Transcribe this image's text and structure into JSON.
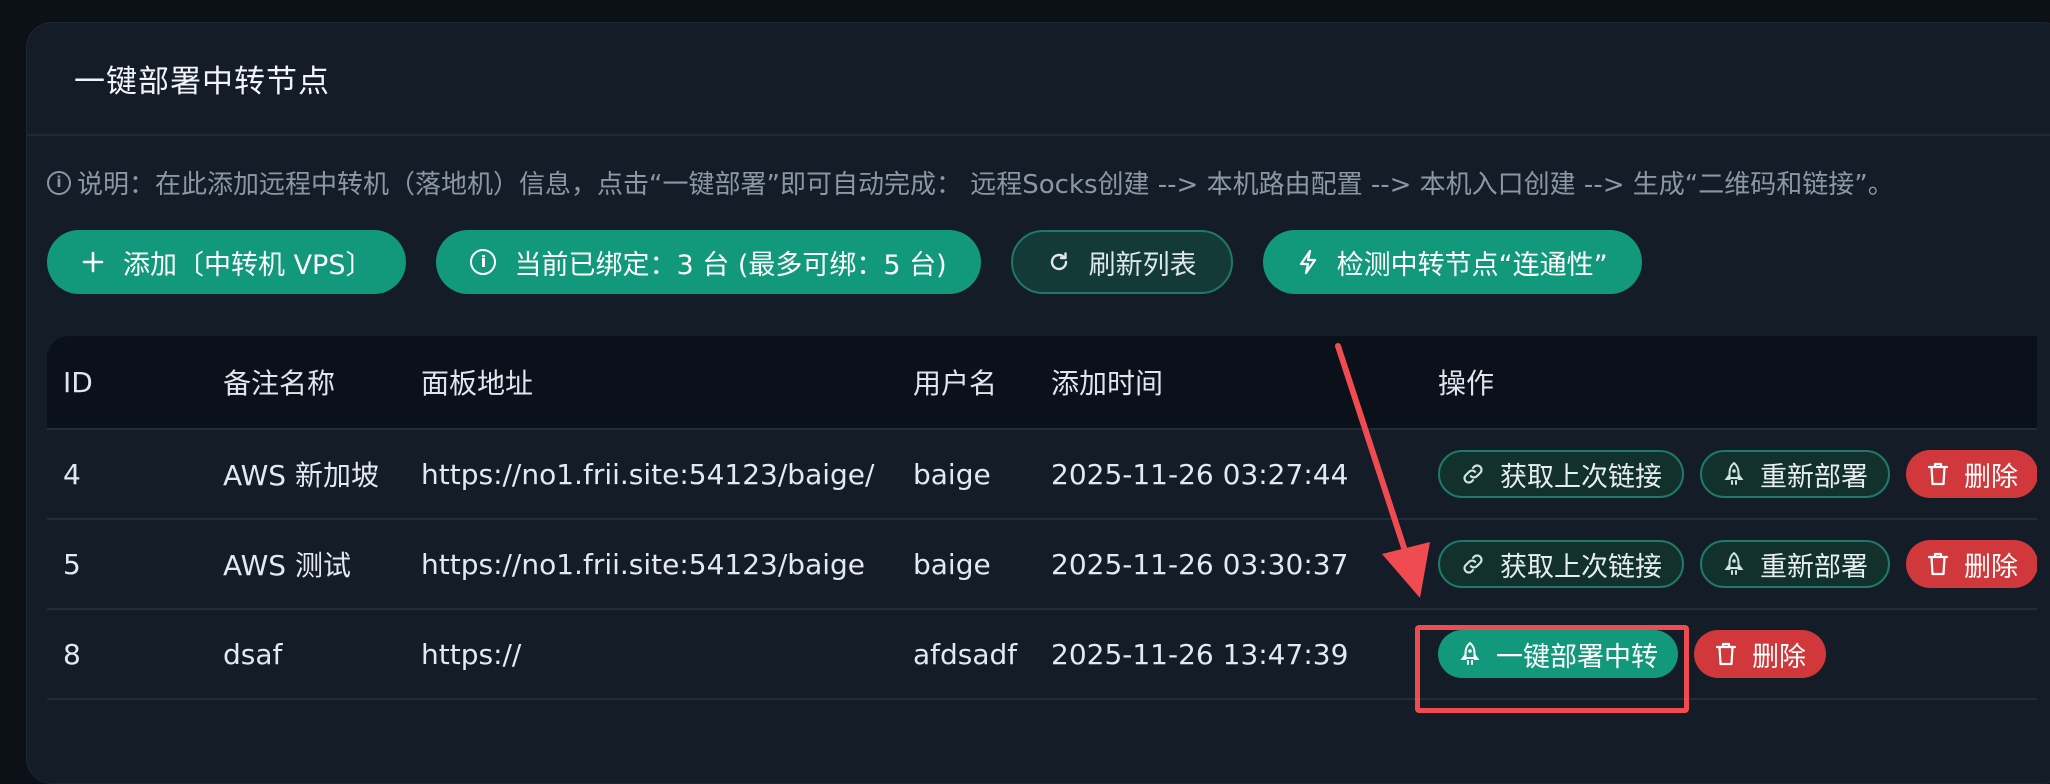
{
  "panel": {
    "title": "一键部署中转节点",
    "notice": "说明：在此添加远程中转机（落地机）信息，点击“一键部署”即可自动完成： 远程Socks创建 --> 本机路由配置 --> 本机入口创建 --> 生成“二维码和链接”。"
  },
  "toolbar": {
    "add_label": "添加〔中转机 VPS〕",
    "bound_label": "当前已绑定：3 台 (最多可绑：5 台)",
    "refresh_label": "刷新列表",
    "check_label": "检测中转节点“连通性”"
  },
  "table": {
    "columns": [
      "ID",
      "备注名称",
      "面板地址",
      "用户名",
      "添加时间",
      "操作"
    ],
    "rows": [
      {
        "id": "4",
        "name": "AWS 新加坡",
        "url": "https://no1.frii.site:54123/baige/",
        "user": "baige",
        "time": "2025-11-26 03:27:44"
      },
      {
        "id": "5",
        "name": "AWS 测试",
        "url": "https://no1.frii.site:54123/baige",
        "user": "baige",
        "time": "2025-11-26 03:30:37"
      },
      {
        "id": "8",
        "name": "dsaf",
        "url": "https://",
        "user": "afdsadf",
        "time": "2025-11-26 13:47:39"
      }
    ]
  },
  "actions": {
    "get_link": "获取上次链接",
    "redeploy": "重新部署",
    "delete": "删除",
    "deploy": "一键部署中转"
  },
  "colors": {
    "accent": "#12987a",
    "danger": "#d0383b",
    "annotation": "#ef4b50"
  }
}
